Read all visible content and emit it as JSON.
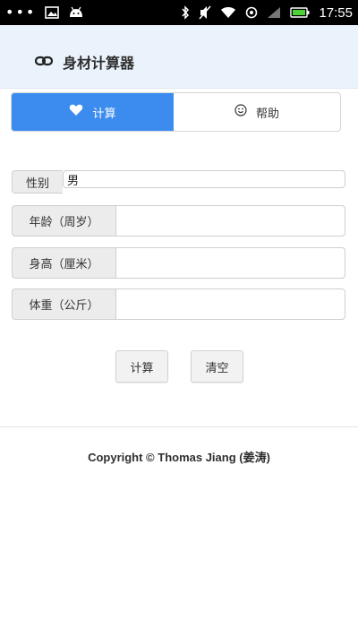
{
  "status_bar": {
    "time": "17:55",
    "dots": "•••"
  },
  "header": {
    "title": "身材计算器"
  },
  "tabs": [
    {
      "label": "计算",
      "icon": "heart-icon",
      "active": true
    },
    {
      "label": "帮助",
      "icon": "smiley-icon",
      "active": false
    }
  ],
  "form": {
    "gender_label": "性别",
    "gender_value": "男",
    "age_label": "年龄（周岁）",
    "age_value": "",
    "height_label": "身高（厘米）",
    "height_value": "",
    "weight_label": "体重（公斤）",
    "weight_value": ""
  },
  "buttons": {
    "calculate": "计算",
    "clear": "清空"
  },
  "footer": {
    "copyright": "Copyright © Thomas Jiang (姜涛)"
  },
  "colors": {
    "accent": "#3c8cf0",
    "header_bg": "#eaf2fb",
    "status_bar_bg": "#000000"
  }
}
